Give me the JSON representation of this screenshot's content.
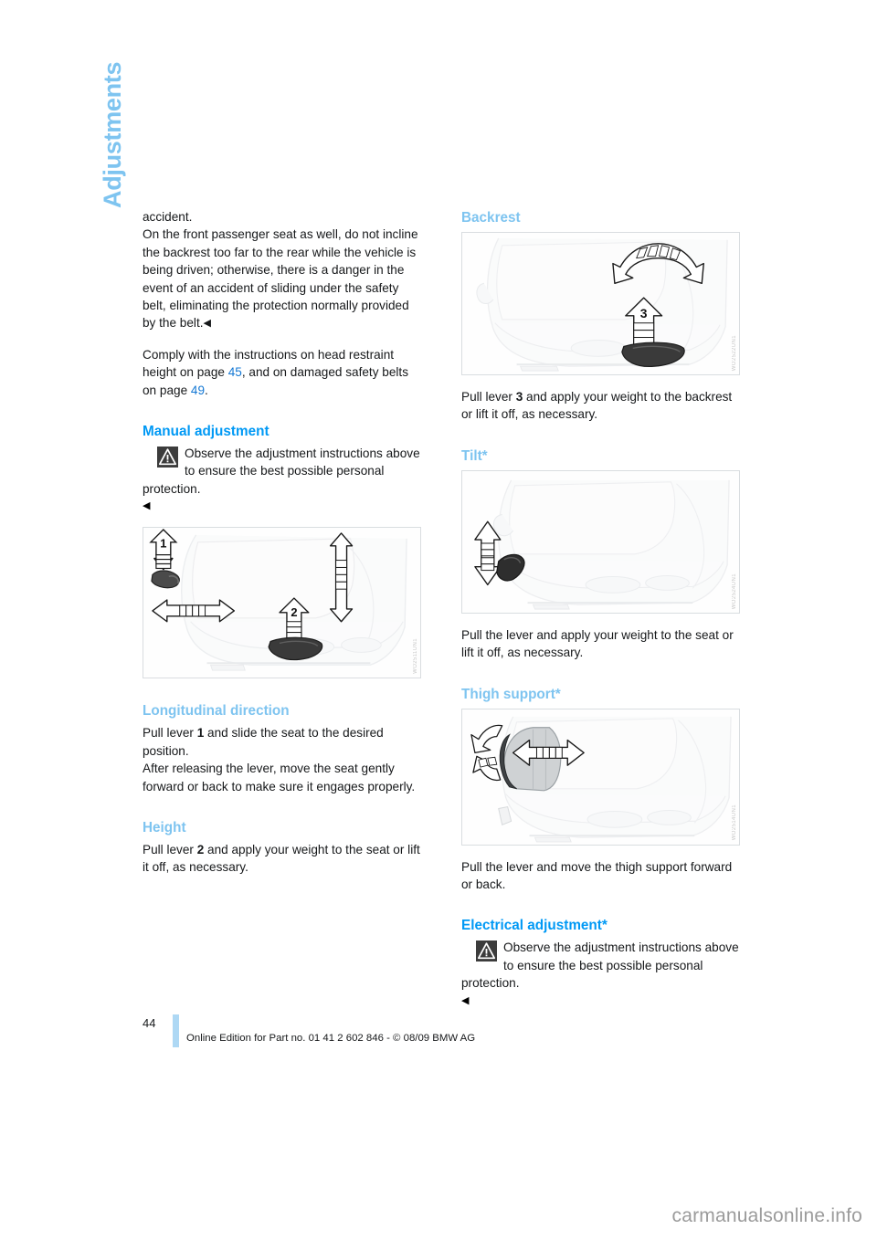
{
  "chapter_tab": "Adjustments",
  "left_column": {
    "intro_paragraph": "accident.\nOn the front passenger seat as well, do not incline the backrest too far to the rear while the vehicle is being driven; otherwise, there is a danger in the event of an accident of sliding under the safety belt, eliminating the protection normally provided by the belt.",
    "intro_line1": "accident.",
    "intro_rest": "On the front passenger seat as well, do not incline the backrest too far to the rear while the vehicle is being driven; otherwise, there is a danger in the event of an accident of sliding under the safety belt, eliminating the protection normally provided by the belt.",
    "comply_pre": "Comply with the instructions on head restraint height on page ",
    "comply_ref1": "45",
    "comply_mid": ", and on damaged safety belts on page ",
    "comply_ref2": "49",
    "comply_end": ".",
    "manual_heading": "Manual adjustment",
    "manual_warning": "Observe the adjustment instructions above to ensure the best possible personal protection.",
    "figure1_code": "WO2511UN1",
    "figure1_labels": [
      "1",
      "2"
    ],
    "longitudinal_heading": "Longitudinal direction",
    "longitudinal_text_pre": "Pull lever ",
    "longitudinal_lever": "1",
    "longitudinal_text_post": " and slide the seat to the desired position.\nAfter releasing the lever, move the seat gently forward or back to make sure it engages properly.",
    "longitudinal_line1_post": " and slide the seat to the desired position.",
    "longitudinal_line2": "After releasing the lever, move the seat gently forward or back to make sure it engages properly.",
    "height_heading": "Height",
    "height_text_pre": "Pull lever ",
    "height_lever": "2",
    "height_text_post": " and apply your weight to the seat or lift it off, as necessary."
  },
  "right_column": {
    "backrest_heading": "Backrest",
    "figure2_code": "WO2522UN1",
    "figure2_label": "3",
    "backrest_text_pre": "Pull lever ",
    "backrest_lever": "3",
    "backrest_text_post": " and apply your weight to the backrest or lift it off, as necessary.",
    "tilt_heading": "Tilt*",
    "figure3_code": "WO2524UN1",
    "tilt_text": "Pull the lever and apply your weight to the seat or lift it off, as necessary.",
    "thigh_heading": "Thigh support*",
    "figure4_code": "WO2514UN1",
    "thigh_text": "Pull the lever and move the thigh support forward or back.",
    "electrical_heading": "Electrical adjustment*",
    "electrical_warning": "Observe the adjustment instructions above to ensure the best possible personal protection."
  },
  "footer": {
    "page_number": "44",
    "edition_text": "Online Edition for Part no. 01 41 2 602 846 - © 08/09 BMW AG"
  },
  "watermark": "carmanualsonline.info",
  "icons": {
    "warning": "warning-triangle-icon",
    "endmark": "◀"
  },
  "colors": {
    "heading_primary": "#0099f5",
    "heading_secondary": "#7ec4f0",
    "page_reference": "#1478d4",
    "footer_bar": "#aed8f4",
    "body_text": "#16181a"
  }
}
